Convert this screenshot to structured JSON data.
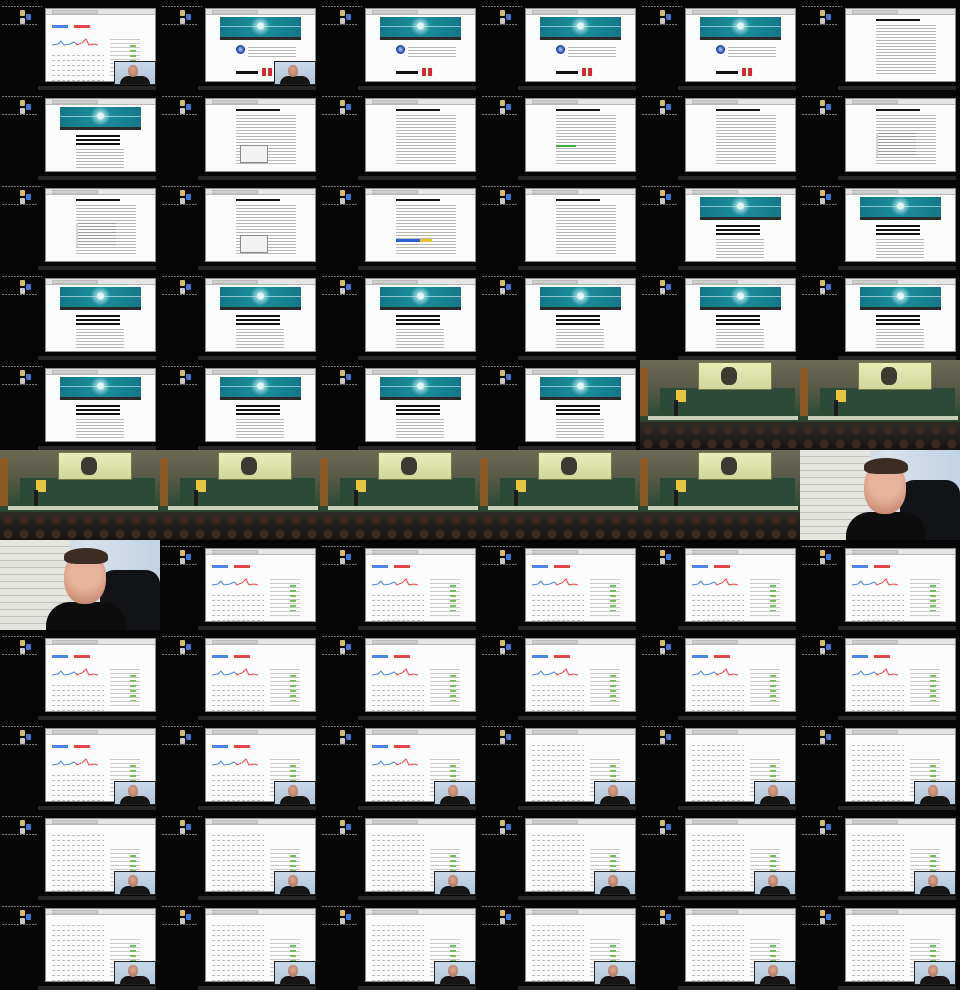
{
  "title": "",
  "grid": {
    "columns": 6,
    "rows": 11
  },
  "frames": [
    {
      "scene": "dashboard",
      "webcam": true
    },
    {
      "scene": "site-home",
      "webcam": true
    },
    {
      "scene": "site-home",
      "webcam": false
    },
    {
      "scene": "site-home",
      "webcam": false
    },
    {
      "scene": "site-home",
      "webcam": false
    },
    {
      "scene": "article-text",
      "webcam": false
    },
    {
      "scene": "site-article",
      "webcam": false
    },
    {
      "scene": "article-diagram",
      "webcam": false
    },
    {
      "scene": "article-text",
      "webcam": false
    },
    {
      "scene": "article-green",
      "webcam": false
    },
    {
      "scene": "article-text",
      "webcam": false
    },
    {
      "scene": "article-code",
      "webcam": false
    },
    {
      "scene": "article-code",
      "webcam": false
    },
    {
      "scene": "article-diagram",
      "webcam": false
    },
    {
      "scene": "article-bluebar",
      "webcam": false
    },
    {
      "scene": "article-text",
      "webcam": false
    },
    {
      "scene": "site-article",
      "webcam": false
    },
    {
      "scene": "site-article",
      "webcam": false
    },
    {
      "scene": "site-article",
      "webcam": false
    },
    {
      "scene": "site-article",
      "webcam": false
    },
    {
      "scene": "site-article",
      "webcam": false
    },
    {
      "scene": "site-article",
      "webcam": false
    },
    {
      "scene": "site-article",
      "webcam": false
    },
    {
      "scene": "site-article",
      "webcam": false
    },
    {
      "scene": "site-article",
      "webcam": false
    },
    {
      "scene": "site-article",
      "webcam": false
    },
    {
      "scene": "site-article",
      "webcam": false
    },
    {
      "scene": "site-article",
      "webcam": false
    },
    {
      "scene": "lecture",
      "webcam": false
    },
    {
      "scene": "lecture",
      "webcam": false
    },
    {
      "scene": "lecture",
      "webcam": false
    },
    {
      "scene": "lecture",
      "webcam": false
    },
    {
      "scene": "lecture",
      "webcam": false
    },
    {
      "scene": "lecture",
      "webcam": false
    },
    {
      "scene": "lecture",
      "webcam": false
    },
    {
      "scene": "webcam",
      "webcam": false
    },
    {
      "scene": "webcam",
      "webcam": false
    },
    {
      "scene": "dashboard",
      "webcam": false
    },
    {
      "scene": "dashboard",
      "webcam": false
    },
    {
      "scene": "dashboard",
      "webcam": false
    },
    {
      "scene": "dashboard",
      "webcam": false
    },
    {
      "scene": "dashboard",
      "webcam": false
    },
    {
      "scene": "dashboard",
      "webcam": false
    },
    {
      "scene": "dashboard",
      "webcam": false
    },
    {
      "scene": "dashboard",
      "webcam": false
    },
    {
      "scene": "dashboard",
      "webcam": false
    },
    {
      "scene": "dashboard",
      "webcam": false
    },
    {
      "scene": "dashboard",
      "webcam": false
    },
    {
      "scene": "dashboard",
      "webcam": true
    },
    {
      "scene": "dashboard",
      "webcam": true
    },
    {
      "scene": "dashboard",
      "webcam": true
    },
    {
      "scene": "dashboard-list",
      "webcam": true
    },
    {
      "scene": "dashboard-list",
      "webcam": true
    },
    {
      "scene": "dashboard-list",
      "webcam": true
    },
    {
      "scene": "dashboard-list",
      "webcam": true
    },
    {
      "scene": "dashboard-list",
      "webcam": true
    },
    {
      "scene": "dashboard-list",
      "webcam": true
    },
    {
      "scene": "dashboard-list",
      "webcam": true
    },
    {
      "scene": "dashboard-list",
      "webcam": true
    },
    {
      "scene": "dashboard-list",
      "webcam": true
    },
    {
      "scene": "dashboard-list",
      "webcam": true
    },
    {
      "scene": "dashboard-list",
      "webcam": true
    },
    {
      "scene": "dashboard-list",
      "webcam": true
    },
    {
      "scene": "dashboard-list",
      "webcam": true
    },
    {
      "scene": "dashboard-list",
      "webcam": true
    },
    {
      "scene": "dashboard-list",
      "webcam": true
    }
  ],
  "colors": {
    "banner": "#0f6c7a",
    "chart_blue": "#4b83e6",
    "chart_red": "#e24747",
    "hall_board": "#2b4a37"
  }
}
